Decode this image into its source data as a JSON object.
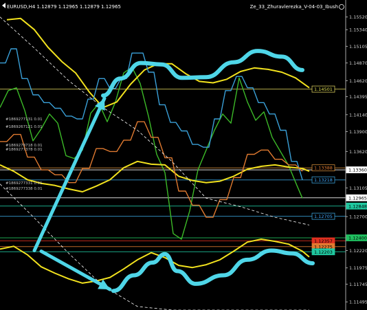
{
  "window": {
    "symbol_info": "EURUSD,H4  1.12879 1.12965 1.12879 1.12965",
    "indicator_name": "Ze_33_Zhuravlerezka_V-04-03_Ibush"
  },
  "chart_data": {
    "type": "line",
    "title": "EURUSD,H4  1.12879 1.12965 1.12879 1.12965",
    "xlabel": "",
    "ylabel": "",
    "ylim": [
      1.1138,
      1.1576
    ],
    "grid": false,
    "y_ticks": [
      "1.15520",
      "1.15340",
      "1.15105",
      "1.14870",
      "1.14620",
      "1.14395",
      "1.14140",
      "1.13900",
      "1.13620",
      "1.13360",
      "1.13105",
      "1.12965",
      "1.12848",
      "1.12700",
      "1.12400",
      "1.12220",
      "1.11975",
      "1.11745",
      "1.11495"
    ],
    "y_tick_values": [
      1.1552,
      1.1534,
      1.15105,
      1.1487,
      1.1462,
      1.14395,
      1.1414,
      1.139,
      1.1362,
      1.1336,
      1.13105,
      1.12965,
      1.12848,
      1.127,
      1.124,
      1.1222,
      1.11975,
      1.11745,
      1.11495
    ],
    "price_markers": [
      {
        "label": "1.14501",
        "value": 1.14501,
        "color": "#d4c95a",
        "text_color": "#e0e050",
        "fill": "#000000"
      },
      {
        "label": "1.13388",
        "value": 1.13388,
        "color": "#d08a3a",
        "text_color": "#e07a30",
        "fill": "#000000"
      },
      {
        "label": "1.13360",
        "value": 1.1336,
        "color": "#ffffff",
        "text_color": "#000000",
        "fill": "#ffffff"
      },
      {
        "label": "1.13218",
        "value": 1.13218,
        "color": "#3aa0d8",
        "text_color": "#40a8ff",
        "fill": "#000000"
      },
      {
        "label": "1.12965",
        "value": 1.12965,
        "color": "#ffffff",
        "text_color": "#000000",
        "fill": "#ffffff"
      },
      {
        "label": "1.12848",
        "value": 1.12848,
        "color": "#20c8a0",
        "text_color": "#000000",
        "fill": "#20c8a0"
      },
      {
        "label": "1.12705",
        "value": 1.12705,
        "color": "#3aa0d8",
        "text_color": "#40a8ff",
        "fill": "#000000"
      },
      {
        "label": "1.12400",
        "value": 1.124,
        "color": "#20c060",
        "text_color": "#000000",
        "fill": "#20c060"
      },
      {
        "label": "1.12357",
        "value": 1.12357,
        "color": "#e03020",
        "text_color": "#000000",
        "fill": "#e03020"
      },
      {
        "label": "1.12275",
        "value": 1.12275,
        "color": "#e07a30",
        "text_color": "#000000",
        "fill": "#e07a30"
      },
      {
        "label": "1.12203",
        "value": 1.12203,
        "color": "#20c8a0",
        "text_color": "#000000",
        "fill": "#20c8a0"
      }
    ],
    "annotations": [
      "#1869277131 0.01",
      "#1869267121 0.01",
      "#1869278718 0.01",
      "#1869277378 0.01",
      "#1869277331 0.01",
      "#1869277338 0.01"
    ],
    "series": [
      {
        "color": "#3cba28",
        "x": [
          0,
          12,
          24,
          36,
          48,
          60,
          72,
          84,
          96,
          108,
          120,
          132,
          144,
          156,
          168,
          180,
          192,
          204,
          216,
          228,
          240,
          252,
          264,
          276,
          288,
          300,
          312,
          324,
          336,
          348,
          360,
          372,
          384,
          396,
          408,
          420,
          432,
          440
        ],
        "values": [
          1.1424,
          1.1448,
          1.1452,
          1.142,
          1.1377,
          1.1394,
          1.1415,
          1.1402,
          1.1356,
          1.1352,
          1.1364,
          1.1416,
          1.143,
          1.1404,
          1.1432,
          1.1473,
          1.1481,
          1.1458,
          1.1412,
          1.1358,
          1.1332,
          1.1246,
          1.1238,
          1.1278,
          1.1336,
          1.1364,
          1.1392,
          1.1415,
          1.1402,
          1.1466,
          1.1432,
          1.1406,
          1.1418,
          1.1382,
          1.1362,
          1.1342,
          1.1314,
          1.1296
        ]
      },
      {
        "color": "#f2e21e",
        "x": [
          10,
          30,
          50,
          70,
          90,
          110,
          130,
          150,
          170,
          190,
          210,
          230,
          250,
          270,
          290,
          310,
          330,
          350,
          370,
          390,
          410,
          430,
          450
        ],
        "values": [
          1.1548,
          1.155,
          1.1534,
          1.1509,
          1.1489,
          1.1473,
          1.1446,
          1.1424,
          1.1432,
          1.1457,
          1.1477,
          1.1486,
          1.1486,
          1.1472,
          1.1461,
          1.1459,
          1.1464,
          1.1475,
          1.148,
          1.1478,
          1.1474,
          1.1466,
          1.1452
        ]
      },
      {
        "color": "#f2e21e",
        "x": [
          0,
          20,
          40,
          60,
          80,
          100,
          120,
          140,
          160,
          180,
          200,
          220,
          240,
          260,
          280,
          300,
          320,
          340,
          360,
          380,
          400,
          420,
          440,
          450
        ],
        "values": [
          1.1343,
          1.1334,
          1.1322,
          1.1317,
          1.1314,
          1.1309,
          1.1305,
          1.1313,
          1.1322,
          1.1339,
          1.1348,
          1.1344,
          1.1343,
          1.1327,
          1.1321,
          1.1318,
          1.132,
          1.1327,
          1.1337,
          1.1341,
          1.1343,
          1.134,
          1.1338,
          1.1334
        ]
      },
      {
        "color": "#f2e21e",
        "x": [
          0,
          20,
          40,
          60,
          80,
          100,
          120,
          140,
          160,
          180,
          200,
          220,
          240,
          260,
          280,
          300,
          320,
          340,
          360,
          380,
          400,
          420,
          440,
          450
        ],
        "values": [
          1.1224,
          1.1228,
          1.1216,
          1.1199,
          1.119,
          1.1182,
          1.1176,
          1.1179,
          1.1184,
          1.1196,
          1.1209,
          1.1219,
          1.1212,
          1.1201,
          1.1198,
          1.1202,
          1.1209,
          1.1221,
          1.1234,
          1.1238,
          1.1235,
          1.1231,
          1.1221,
          1.1213
        ]
      },
      {
        "color": "#3aa0d8",
        "x": [
          0,
          8,
          16,
          24,
          32,
          40,
          48,
          56,
          64,
          72,
          80,
          88,
          96,
          104,
          112,
          120,
          128,
          136,
          144,
          152,
          160,
          168,
          176,
          184,
          192,
          200,
          208,
          216,
          224,
          232,
          240,
          248,
          256,
          264,
          272,
          280,
          288,
          296,
          304,
          312,
          320,
          328,
          336,
          344,
          352,
          360,
          368,
          376,
          384,
          392,
          400,
          408,
          416,
          424,
          432,
          440
        ],
        "values": [
          1.1487,
          1.1487,
          1.1507,
          1.1507,
          1.1465,
          1.1465,
          1.1442,
          1.1442,
          1.1431,
          1.1431,
          1.1423,
          1.1423,
          1.1412,
          1.1412,
          1.1408,
          1.1408,
          1.1436,
          1.1436,
          1.1465,
          1.1465,
          1.1451,
          1.1451,
          1.1465,
          1.1465,
          1.1501,
          1.1501,
          1.1501,
          1.1474,
          1.1474,
          1.1428,
          1.1428,
          1.1403,
          1.1403,
          1.1391,
          1.1391,
          1.1372,
          1.1372,
          1.1368,
          1.1368,
          1.1408,
          1.1408,
          1.1448,
          1.1448,
          1.1468,
          1.1468,
          1.1452,
          1.1452,
          1.1431,
          1.1431,
          1.1415,
          1.1415,
          1.1392,
          1.1392,
          1.1348,
          1.1348,
          1.1322
        ]
      },
      {
        "color": "#e07a30",
        "x": [
          0,
          10,
          20,
          30,
          40,
          50,
          60,
          70,
          80,
          90,
          100,
          110,
          120,
          130,
          140,
          150,
          160,
          170,
          180,
          190,
          200,
          210,
          220,
          230,
          240,
          250,
          260,
          270,
          280,
          290,
          300,
          310,
          320,
          330,
          340,
          350,
          360,
          370,
          380,
          390,
          400,
          410,
          420,
          430,
          440
        ],
        "values": [
          1.1376,
          1.1376,
          1.1386,
          1.1386,
          1.1354,
          1.1354,
          1.1336,
          1.1336,
          1.1329,
          1.1329,
          1.1318,
          1.1318,
          1.1338,
          1.1338,
          1.1366,
          1.1366,
          1.1362,
          1.1362,
          1.1378,
          1.1378,
          1.1404,
          1.1404,
          1.1382,
          1.1382,
          1.1353,
          1.1353,
          1.1306,
          1.1306,
          1.1286,
          1.1286,
          1.1269,
          1.1269,
          1.1294,
          1.1294,
          1.1325,
          1.1325,
          1.1358,
          1.1358,
          1.1364,
          1.1364,
          1.1351,
          1.1351,
          1.1343,
          1.1343,
          1.1334
        ]
      },
      {
        "color": "#ffffff",
        "dashed": true,
        "x": [
          0,
          50,
          100,
          150,
          200,
          250,
          300,
          350,
          400,
          450
        ],
        "values": [
          1.1552,
          1.1508,
          1.1462,
          1.1424,
          1.1392,
          1.1348,
          1.1296,
          1.1284,
          1.1269,
          1.1258
        ]
      },
      {
        "color": "#ffffff",
        "dashed": true,
        "x": [
          0,
          50,
          100,
          150,
          200,
          250,
          300,
          350,
          400,
          450
        ],
        "values": [
          1.1316,
          1.1268,
          1.1218,
          1.1172,
          1.1143,
          1.1138,
          1.1138,
          1.1138,
          1.1138,
          1.1138
        ]
      }
    ],
    "drawn_shapes": [
      {
        "kind": "wave",
        "color": "#4fd6e8",
        "x": [
          150,
          175,
          205,
          235,
          265,
          300,
          340,
          375,
          410,
          440
        ],
        "values": [
          1.1441,
          1.1465,
          1.1487,
          1.1485,
          1.1466,
          1.1467,
          1.1488,
          1.1504,
          1.1496,
          1.1477
        ]
      },
      {
        "kind": "wave",
        "color": "#4fd6e8",
        "x": [
          165,
          195,
          222,
          240,
          258,
          285,
          325,
          360,
          395,
          425,
          455
        ],
        "values": [
          1.1165,
          1.1187,
          1.1205,
          1.1217,
          1.1193,
          1.1175,
          1.1187,
          1.1209,
          1.1222,
          1.1218,
          1.1204
        ]
      },
      {
        "kind": "arrow",
        "color": "#4fd6e8",
        "x": [
          50,
          152
        ],
        "values": [
          1.1222,
          1.1437
        ]
      },
      {
        "kind": "arrow",
        "color": "#4fd6e8",
        "x": [
          60,
          160
        ],
        "values": [
          1.1221,
          1.1167
        ]
      }
    ]
  }
}
